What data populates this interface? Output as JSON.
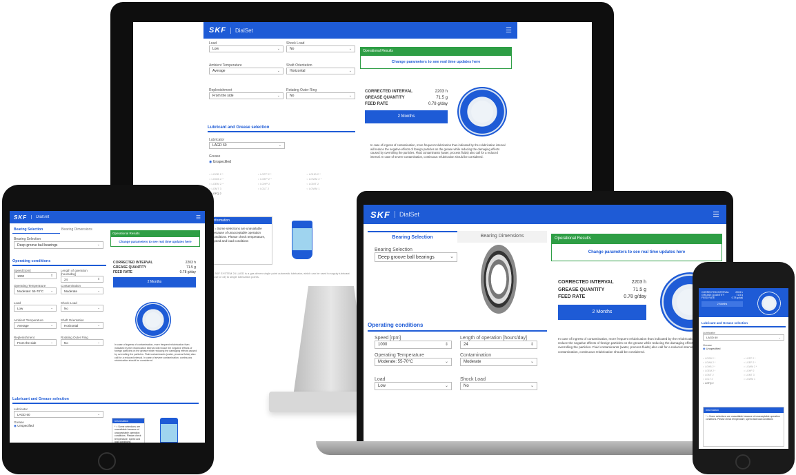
{
  "app": {
    "logo": "SKF",
    "name": "DialSet",
    "menu_icon": "hamburger-icon"
  },
  "tabs": {
    "bearing_selection": "Bearing Selection",
    "bearing_dimensions": "Bearing Dimensions"
  },
  "bearing": {
    "label": "Bearing Selection",
    "value": "Deep groove ball bearings"
  },
  "operating_conditions": {
    "title": "Operating conditions",
    "speed_label": "Speed [rpm]",
    "speed_value": "1000",
    "length_label": "Length of operation [hours/day]",
    "length_value": "24",
    "temp_label": "Operating Temperature",
    "temp_value": "Moderate: 55-70°C",
    "contamination_label": "Contamination",
    "contamination_value": "Moderate",
    "load_label": "Load",
    "load_value": "Low",
    "shock_label": "Shock Load",
    "shock_value": "No",
    "ambient_label": "Ambient Temperature",
    "ambient_value": "Average",
    "shaft_label": "Shaft Orientation",
    "shaft_value": "Horizontal",
    "replenishment_label": "Replenishment",
    "replenishment_value": "From the side",
    "rotating_label": "Rotating Outer Ring",
    "rotating_value": "No"
  },
  "lubricant": {
    "title": "Lubricant and Grease selection",
    "lubricator_label": "Lubricator",
    "lubricator_value": "LAGD 60",
    "grease_label": "Grease",
    "grease_value": "Unspecified",
    "options": [
      "LGGB 2 *",
      "LGFP 2 *",
      "LGWA 2 *",
      "LGEP 2 *",
      "LGHB 2 *",
      "LGWM 2 *",
      "LGEM 2 *",
      "LGHP 2",
      "LGMT 2",
      "LGMT 3",
      "LGLT 2",
      "LGWM 1",
      "LGFQ 2"
    ]
  },
  "information": {
    "title": "Information",
    "text": "* = Some selections are unavailable because of unacceptable operation conditions. Please check temperature, speed and load conditions"
  },
  "results": {
    "header": "Operational Results",
    "prompt": "Change parameters to see real time updates here",
    "corrected_label": "CORRECTED INTERVAL",
    "corrected_value": "2203 h",
    "grease_label": "GREASE QUANTITY",
    "grease_value": "71.5 g",
    "feed_label": "FEED RATE",
    "feed_value": "0.78 g/day",
    "months_button": "2 Months",
    "note": "In case of ingress of contamination, more frequent relubrication than indicated by the relubrication interval will reduce the negative effects of foreign particles on the grease while reducing the damaging effects caused by overrolling the particles. Fluid contaminants (water, process fluids) also call for a reduced interval. In case of severe contamination, continuous relubrication should be considered."
  },
  "footer_note": "The SKF SYSTEM 24 LAGD is a gas driven single point automatic lubricator, which can be used to supply lubricant (grease or oil) to single lubrication points.",
  "colors": {
    "brand_blue": "#1e5bd6",
    "results_green": "#2e9e45",
    "device_black": "#111111"
  }
}
